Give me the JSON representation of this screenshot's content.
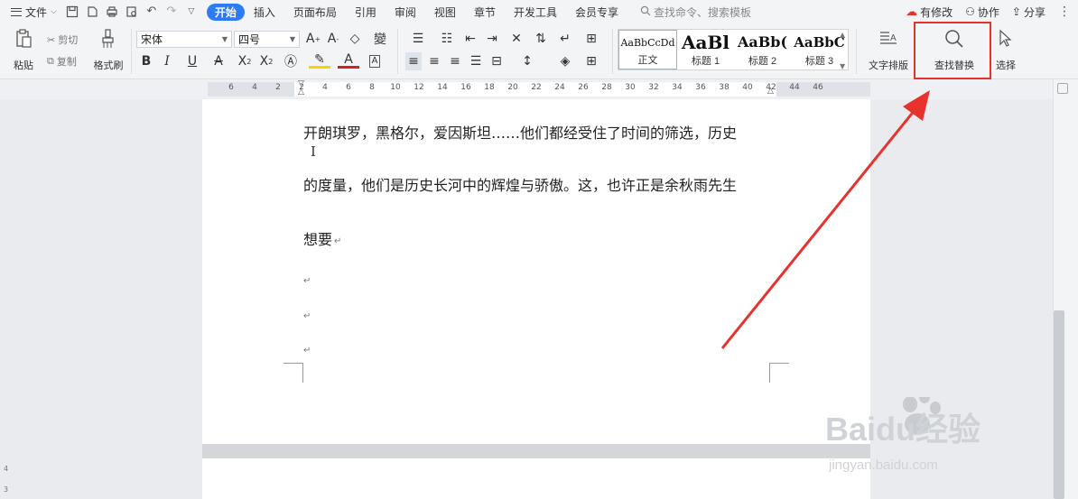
{
  "menubar": {
    "file_label": "文件",
    "tabs": [
      "开始",
      "插入",
      "页面布局",
      "引用",
      "审阅",
      "视图",
      "章节",
      "开发工具",
      "会员专享"
    ],
    "search_placeholder": "查找命令、搜索模板",
    "right": {
      "revise": "有修改",
      "collab": "协作",
      "share": "分享"
    }
  },
  "ribbon": {
    "paste": "粘贴",
    "cut": "剪切",
    "copy": "复制",
    "format_painter": "格式刷",
    "font_name": "宋体",
    "font_size": "四号",
    "styles": [
      {
        "preview": "AaBbCcDd",
        "caption": "正文"
      },
      {
        "preview": "AaBl",
        "caption": "标题 1"
      },
      {
        "preview": "AaBb(",
        "caption": "标题 2"
      },
      {
        "preview": "AaBbC",
        "caption": "标题 3"
      }
    ],
    "text_layout": "文字排版",
    "find_replace": "查找替换",
    "select": "选择"
  },
  "ruler": {
    "numbers": [
      "6",
      "4",
      "2",
      "2",
      "4",
      "6",
      "8",
      "10",
      "12",
      "14",
      "16",
      "18",
      "20",
      "22",
      "24",
      "26",
      "28",
      "30",
      "32",
      "34",
      "36",
      "38",
      "40",
      "42",
      "44",
      "46"
    ]
  },
  "document": {
    "lines": [
      "开朗琪罗，黑格尔，爱因斯坦……他们都经受住了时间的筛选，历史",
      "的度量，他们是历史长河中的辉煌与骄傲。这，也许正是余秋雨先生",
      "想要"
    ],
    "return_mark": "↵"
  },
  "watermark": {
    "brand": "Baidu经验",
    "url": "jingyan.baidu.com"
  },
  "colors": {
    "accent": "#2d7cf6",
    "highlight": "#e8322e"
  }
}
